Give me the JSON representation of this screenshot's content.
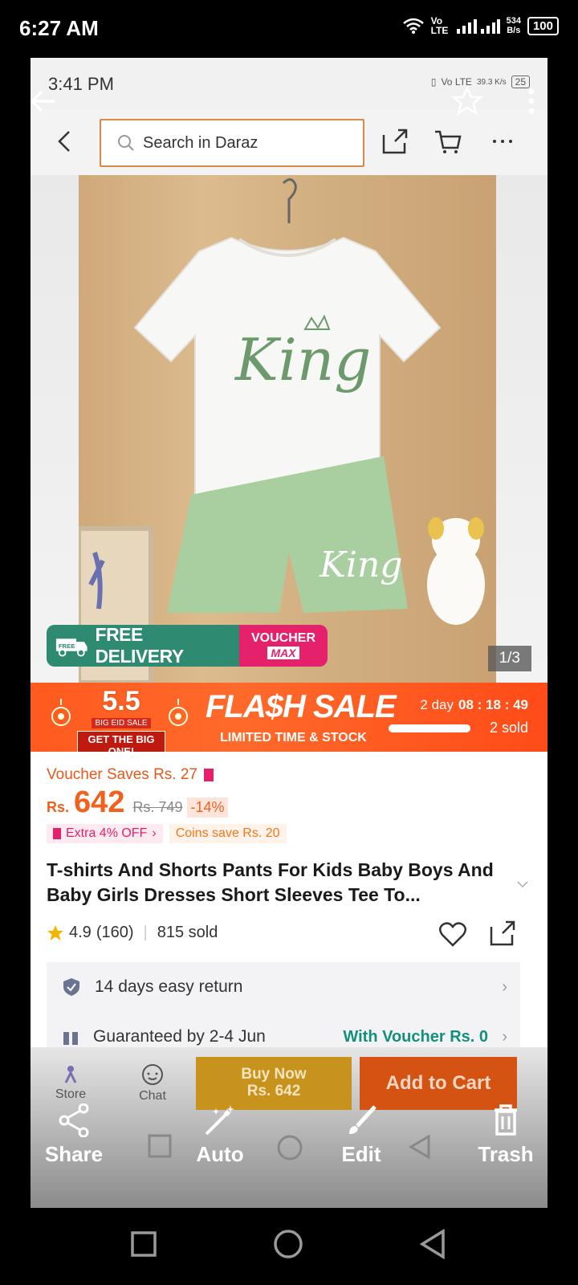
{
  "status_bar": {
    "time": "6:27 AM",
    "network": "Vo LTE",
    "speed_value": "534",
    "speed_unit": "B/s",
    "battery": "100"
  },
  "inner_status": {
    "time": "3:41 PM",
    "network": "Vo LTE",
    "speed": "39.3 K/s",
    "battery": "25"
  },
  "header": {
    "search_placeholder": "Search in Daraz"
  },
  "product_image": {
    "shirt_print": "King",
    "shorts_print": "King",
    "free_delivery": "FREE DELIVERY",
    "free_tag": "FREE",
    "voucher_line1": "VOUCHER",
    "voucher_line2": "MAX",
    "counter": "1/3"
  },
  "flash_sale": {
    "eid_number": "5.5",
    "eid_sub": "BIG EID SALE",
    "eid_tagline": "GET THE BIG ONE!",
    "title": "FLA$H SALE",
    "subtitle": "LIMITED TIME & STOCK",
    "countdown_day": "2 day",
    "countdown_h": "08",
    "countdown_m": "18",
    "countdown_s": "49",
    "sold": "2 sold",
    "sold_fraction": 1.0
  },
  "price": {
    "voucher_saves": "Voucher Saves Rs. 27",
    "currency": "Rs.",
    "current": "642",
    "original": "Rs. 749",
    "discount": "-14%",
    "extra_off": "Extra 4% OFF",
    "coins": "Coins save Rs. 20"
  },
  "product": {
    "title": "T-shirts And Shorts Pants For Kids Baby Boys And Baby Girls Dresses Short Sleeves Tee To...",
    "rating": "4.9",
    "reviews": "(160)",
    "sold": "815 sold"
  },
  "services": {
    "return": "14 days easy return",
    "delivery": "Guaranteed by 2-4 Jun",
    "voucher": "With Voucher Rs. 0"
  },
  "bottom_bar": {
    "store": "Store",
    "chat": "Chat",
    "buy_now_1": "Buy Now",
    "buy_now_2": "Rs. 642",
    "add_to_cart": "Add to Cart"
  },
  "overlay_actions": {
    "share": "Share",
    "auto": "Auto",
    "edit": "Edit",
    "trash": "Trash"
  },
  "colors": {
    "brand_orange": "#f3601c",
    "voucher_pink": "#e6216b",
    "delivery_green": "#2f8a72",
    "search_border": "#d9884a"
  }
}
